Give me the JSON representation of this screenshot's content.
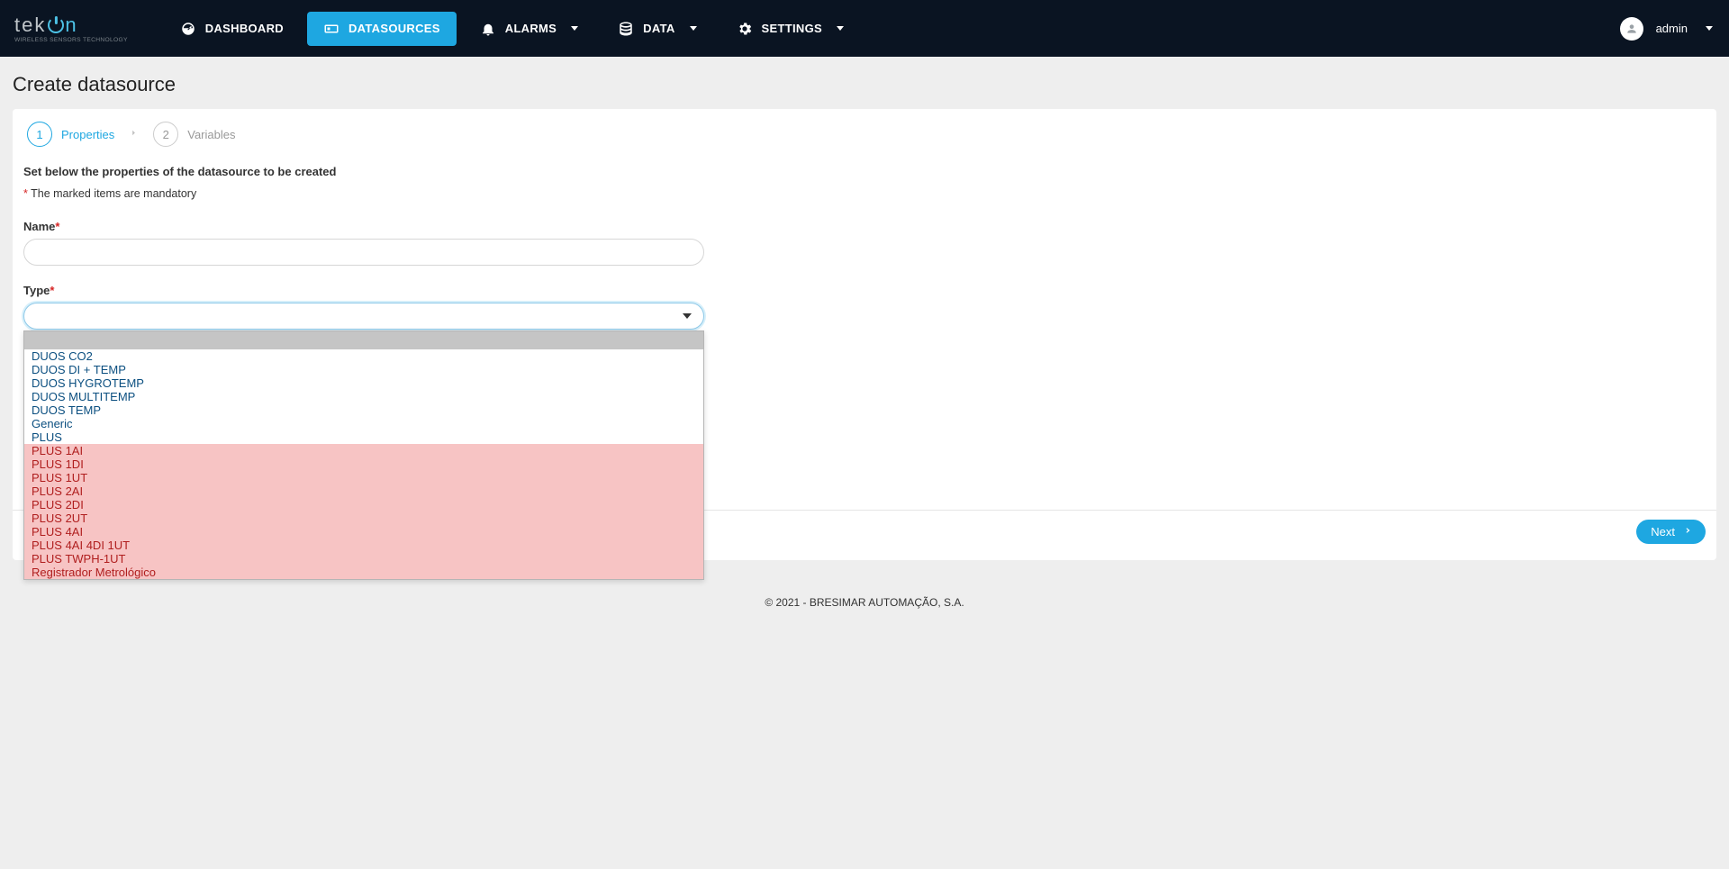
{
  "logo": {
    "text_gray": "tek",
    "text_accent": "n",
    "sub": "WIRELESS SENSORS TECHNOLOGY"
  },
  "nav": {
    "dashboard": "DASHBOARD",
    "datasources": "DATASOURCES",
    "alarms": "ALARMS",
    "data": "DATA",
    "settings": "SETTINGS"
  },
  "user": {
    "name": "admin"
  },
  "page": {
    "title": "Create datasource"
  },
  "stepper": {
    "step1_num": "1",
    "step1_label": "Properties",
    "step2_num": "2",
    "step2_label": "Variables"
  },
  "form": {
    "intro": "Set below the properties of the datasource to be created",
    "mandatory_marker": "*",
    "mandatory_text": " The marked items are mandatory",
    "name_label": "Name",
    "name_value": "",
    "type_label": "Type",
    "type_value": ""
  },
  "dropdown": {
    "options": [
      {
        "label": "DUOS CO2",
        "disabled": false
      },
      {
        "label": "DUOS DI + TEMP",
        "disabled": false
      },
      {
        "label": "DUOS HYGROTEMP",
        "disabled": false
      },
      {
        "label": "DUOS MULTITEMP",
        "disabled": false
      },
      {
        "label": "DUOS TEMP",
        "disabled": false
      },
      {
        "label": "Generic",
        "disabled": false
      },
      {
        "label": "PLUS",
        "disabled": false
      },
      {
        "label": "PLUS 1AI",
        "disabled": true
      },
      {
        "label": "PLUS 1DI",
        "disabled": true
      },
      {
        "label": "PLUS 1UT",
        "disabled": true
      },
      {
        "label": "PLUS 2AI",
        "disabled": true
      },
      {
        "label": "PLUS 2DI",
        "disabled": true
      },
      {
        "label": "PLUS 2UT",
        "disabled": true
      },
      {
        "label": "PLUS 4AI",
        "disabled": true
      },
      {
        "label": "PLUS 4AI 4DI 1UT",
        "disabled": true
      },
      {
        "label": "PLUS TWPH-1UT",
        "disabled": true
      },
      {
        "label": "Registrador Metrológico",
        "disabled": true
      }
    ]
  },
  "buttons": {
    "next": "Next"
  },
  "footer": "© 2021 - BRESIMAR AUTOMAÇÃO, S.A."
}
